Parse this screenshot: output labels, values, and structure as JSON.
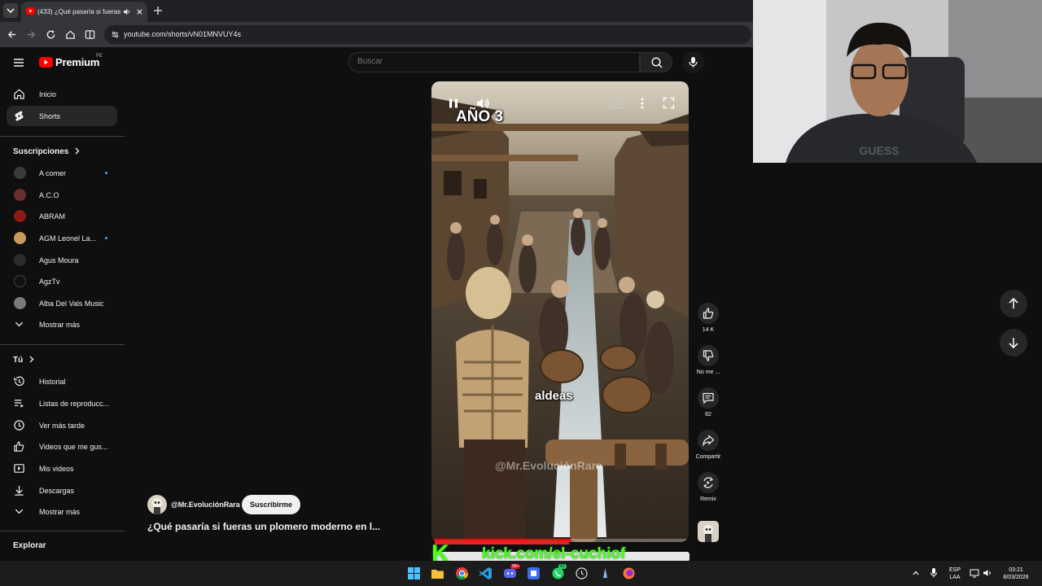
{
  "browser": {
    "tab_title": "(433) ¿Qué pasaría si fueras",
    "url": "youtube.com/shorts/vN01MNVUY4s"
  },
  "header": {
    "logo_text": "Premium",
    "region": "PE",
    "search_placeholder": "Buscar"
  },
  "sidebar": {
    "main": [
      {
        "label": "Inicio",
        "icon": "home-icon"
      },
      {
        "label": "Shorts",
        "icon": "shorts-icon",
        "active": true
      }
    ],
    "subscriptions_title": "Suscripciones",
    "subscriptions": [
      {
        "label": "A comer",
        "new": true,
        "color": "#3b3b3b"
      },
      {
        "label": "A.C.O",
        "new": false,
        "color": "#6b2e2e"
      },
      {
        "label": "ABRAM",
        "new": false,
        "color": "#8a1a1a"
      },
      {
        "label": "AGM Leonel La...",
        "new": true,
        "color": "#c89a5e"
      },
      {
        "label": "Agus Moura",
        "new": false,
        "color": "#2c2c2c"
      },
      {
        "label": "AgzTv",
        "new": false,
        "color": "#111111"
      },
      {
        "label": "Alba Del Vals Music",
        "new": false,
        "color": "#7a7a7a"
      }
    ],
    "show_more": "Mostrar más",
    "you_title": "Tú",
    "you_items": [
      {
        "label": "Historial",
        "icon": "history-icon"
      },
      {
        "label": "Listas de reproducc...",
        "icon": "playlists-icon"
      },
      {
        "label": "Ver más tarde",
        "icon": "watch-later-icon"
      },
      {
        "label": "Videos que me gus...",
        "icon": "liked-icon"
      },
      {
        "label": "Mis videos",
        "icon": "my-videos-icon"
      },
      {
        "label": "Descargas",
        "icon": "download-icon"
      }
    ],
    "show_more_2": "Mostrar más",
    "explore_title": "Explorar"
  },
  "short": {
    "overlay_title": "AÑO 3",
    "caption": "aldeas",
    "watermark": "@Mr.EvoluciónRara",
    "channel": "@Mr.EvoluciónRara",
    "subscribe_label": "Suscribirme",
    "title": "¿Qué pasaría si fueras un plomero moderno en l...",
    "progress_fraction": 0.54
  },
  "actions": {
    "likes": "14 K",
    "dislike": "No me ...",
    "comments": "82",
    "share": "Compartir",
    "remix": "Remix"
  },
  "stream_overlay": {
    "text": "kick.com/el-cuchiof",
    "letter": "K"
  },
  "taskbar": {
    "lang": "ESP",
    "lang2": "LAA",
    "time": "03:21",
    "date": "8/03/2026",
    "chat_badge": "41",
    "discord_badge": "99+"
  }
}
